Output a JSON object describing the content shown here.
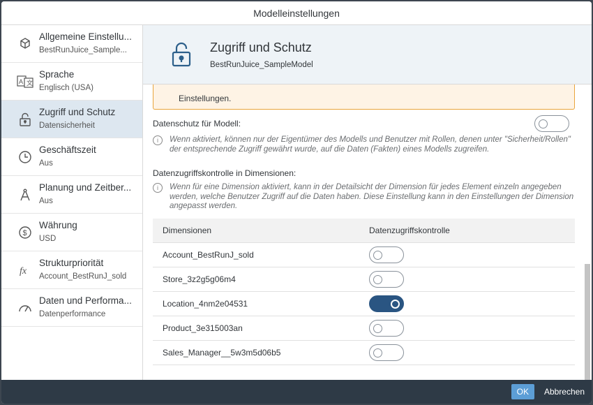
{
  "dialog": {
    "title": "Modelleinstellungen"
  },
  "sidebar": {
    "items": [
      {
        "label": "Allgemeine Einstellu...",
        "sub": "BestRunJuice_Sample...",
        "icon": "cube-icon"
      },
      {
        "label": "Sprache",
        "sub": "Englisch (USA)",
        "icon": "translate-icon"
      },
      {
        "label": "Zugriff und Schutz",
        "sub": "Datensicherheit",
        "icon": "unlock-icon"
      },
      {
        "label": "Geschäftszeit",
        "sub": "Aus",
        "icon": "clock-icon"
      },
      {
        "label": "Planung und Zeitber...",
        "sub": "Aus",
        "icon": "compass-icon"
      },
      {
        "label": "Währung",
        "sub": "USD",
        "icon": "currency-icon"
      },
      {
        "label": "Strukturpriorität",
        "sub": "Account_BestRunJ_sold",
        "icon": "function-icon"
      },
      {
        "label": "Daten und Performa...",
        "sub": "Datenperformance",
        "icon": "gauge-icon"
      }
    ],
    "active_index": 2
  },
  "header": {
    "title": "Zugriff und Schutz",
    "subtitle": "BestRunJuice_SampleModel"
  },
  "warning": {
    "text": "Einstellungen."
  },
  "privacy": {
    "label": "Datenschutz für Modell:",
    "enabled": false,
    "info": "Wenn aktiviert, können nur der Eigentümer des Modells und Benutzer mit Rollen, denen unter \"Sicherheit/Rollen\" der entsprechende Zugriff gewährt wurde, auf die Daten (Fakten) eines Modells zugreifen."
  },
  "dac": {
    "label": "Datenzugriffskontrolle in Dimensionen:",
    "info": "Wenn für eine Dimension aktiviert, kann in der Detailsicht der Dimension für jedes Element einzeln angegeben werden, welche Benutzer Zugriff auf die Daten haben. Diese Einstellung kann in den Einstellungen der Dimension angepasst werden."
  },
  "table": {
    "headers": [
      "Dimensionen",
      "Datenzugriffskontrolle"
    ],
    "rows": [
      {
        "name": "Account_BestRunJ_sold",
        "enabled": false
      },
      {
        "name": "Store_3z2g5g06m4",
        "enabled": false
      },
      {
        "name": "Location_4nm2e04531",
        "enabled": true
      },
      {
        "name": "Product_3e315003an",
        "enabled": false
      },
      {
        "name": "Sales_Manager__5w3m5d06b5",
        "enabled": false
      }
    ]
  },
  "footer": {
    "ok": "OK",
    "cancel": "Abbrechen"
  }
}
